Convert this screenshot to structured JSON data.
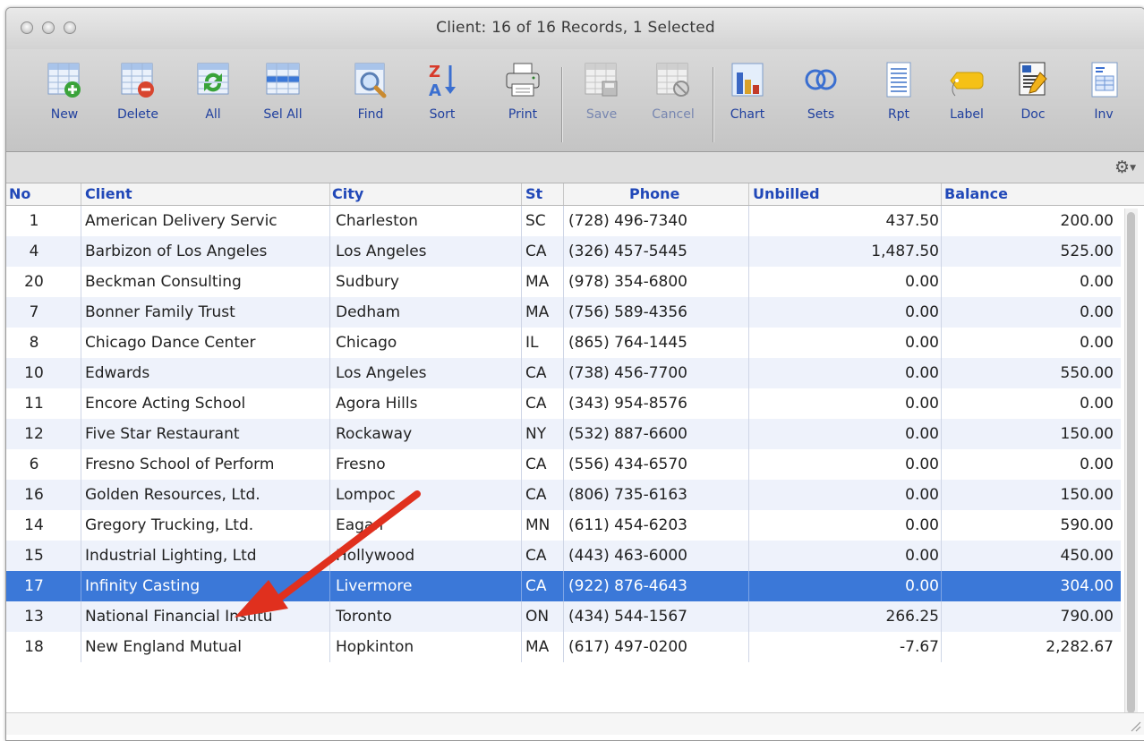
{
  "window": {
    "title": "Client: 16 of 16 Records, 1 Selected"
  },
  "toolbar": {
    "buttons": [
      {
        "label": "New",
        "icon": "table-add-icon"
      },
      {
        "label": "Delete",
        "icon": "table-delete-icon"
      },
      {
        "label": "All",
        "icon": "table-refresh-icon"
      },
      {
        "label": "Sel All",
        "icon": "table-select-all-icon"
      },
      {
        "label": "Find",
        "icon": "magnifier-icon"
      },
      {
        "label": "Sort",
        "icon": "sort-za-icon"
      },
      {
        "label": "Print",
        "icon": "printer-icon"
      },
      {
        "label": "Save",
        "icon": "save-record-icon"
      },
      {
        "label": "Cancel",
        "icon": "cancel-record-icon"
      },
      {
        "label": "Chart",
        "icon": "bar-chart-icon"
      },
      {
        "label": "Sets",
        "icon": "venn-sets-icon"
      },
      {
        "label": "Rpt",
        "icon": "report-icon"
      },
      {
        "label": "Label",
        "icon": "tag-label-icon"
      },
      {
        "label": "Doc",
        "icon": "document-edit-icon"
      },
      {
        "label": "Inv",
        "icon": "invoice-icon"
      }
    ]
  },
  "table": {
    "columns": [
      "No",
      "Client",
      "City",
      "St",
      "Phone",
      "Unbilled",
      "Balance"
    ],
    "rows": [
      {
        "no": "1",
        "client": "American Delivery Servic",
        "city": "Charleston",
        "st": "SC",
        "phone": "(728) 496-7340",
        "unbilled": "437.50",
        "balance": "200.00"
      },
      {
        "no": "4",
        "client": "Barbizon of Los Angeles",
        "city": "Los Angeles",
        "st": "CA",
        "phone": "(326) 457-5445",
        "unbilled": "1,487.50",
        "balance": "525.00"
      },
      {
        "no": "20",
        "client": "Beckman Consulting",
        "city": "Sudbury",
        "st": "MA",
        "phone": "(978) 354-6800",
        "unbilled": "0.00",
        "balance": "0.00"
      },
      {
        "no": "7",
        "client": "Bonner Family Trust",
        "city": "Dedham",
        "st": "MA",
        "phone": "(756) 589-4356",
        "unbilled": "0.00",
        "balance": "0.00"
      },
      {
        "no": "8",
        "client": "Chicago Dance Center",
        "city": "Chicago",
        "st": "IL",
        "phone": "(865) 764-1445",
        "unbilled": "0.00",
        "balance": "0.00"
      },
      {
        "no": "10",
        "client": "Edwards",
        "city": "Los Angeles",
        "st": "CA",
        "phone": "(738) 456-7700",
        "unbilled": "0.00",
        "balance": "550.00"
      },
      {
        "no": "11",
        "client": "Encore Acting School",
        "city": "Agora Hills",
        "st": "CA",
        "phone": "(343) 954-8576",
        "unbilled": "0.00",
        "balance": "0.00"
      },
      {
        "no": "12",
        "client": "Five Star Restaurant",
        "city": "Rockaway",
        "st": "NY",
        "phone": "(532) 887-6600",
        "unbilled": "0.00",
        "balance": "150.00"
      },
      {
        "no": "6",
        "client": "Fresno School of Perform",
        "city": "Fresno",
        "st": "CA",
        "phone": "(556) 434-6570",
        "unbilled": "0.00",
        "balance": "0.00"
      },
      {
        "no": "16",
        "client": "Golden Resources, Ltd.",
        "city": "Lompoc",
        "st": "CA",
        "phone": "(806) 735-6163",
        "unbilled": "0.00",
        "balance": "150.00"
      },
      {
        "no": "14",
        "client": "Gregory Trucking, Ltd.",
        "city": "Eagan",
        "st": "MN",
        "phone": "(611) 454-6203",
        "unbilled": "0.00",
        "balance": "590.00"
      },
      {
        "no": "15",
        "client": "Industrial Lighting, Ltd",
        "city": "Hollywood",
        "st": "CA",
        "phone": "(443) 463-6000",
        "unbilled": "0.00",
        "balance": "450.00"
      },
      {
        "no": "17",
        "client": "Infinity Casting",
        "city": "Livermore",
        "st": "CA",
        "phone": "(922) 876-4643",
        "unbilled": "0.00",
        "balance": "304.00",
        "selected": true
      },
      {
        "no": "13",
        "client": "National Financial Institu",
        "city": "Toronto",
        "st": "ON",
        "phone": "(434) 544-1567",
        "unbilled": "266.25",
        "balance": "790.00"
      },
      {
        "no": "18",
        "client": "New England Mutual",
        "city": "Hopkinton",
        "st": "MA",
        "phone": "(617) 497-0200",
        "unbilled": "-7.67",
        "balance": "2,282.67"
      }
    ]
  },
  "colors": {
    "selection": "#3b78d8",
    "header_text": "#2148b8",
    "annotation_arrow": "#e0301e"
  }
}
